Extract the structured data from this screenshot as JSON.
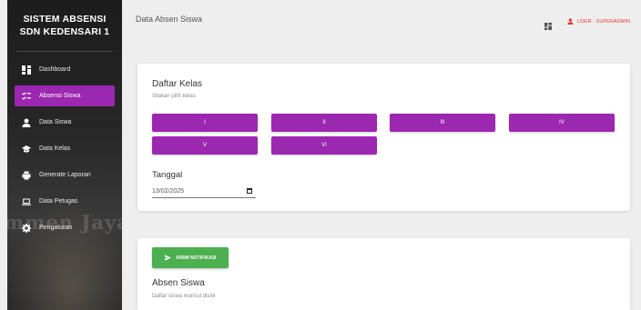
{
  "sidebar": {
    "brand_line1": "SISTEM ABSENSI",
    "brand_line2": "SDN KEDENSARI 1",
    "watermark": "mmen Jayand",
    "items": [
      {
        "label": "Dashboard",
        "icon": "dashboard-icon"
      },
      {
        "label": "Absensi Siswa",
        "icon": "checklist-icon",
        "active": true
      },
      {
        "label": "Data Siswa",
        "icon": "person-icon"
      },
      {
        "label": "Data Kelas",
        "icon": "school-icon"
      },
      {
        "label": "Generate Laporan",
        "icon": "print-icon"
      },
      {
        "label": "Data Petugas",
        "icon": "laptop-icon"
      },
      {
        "label": "Pengaturan",
        "icon": "gear-icon"
      }
    ]
  },
  "header": {
    "title": "Data Absen Siswa",
    "user_label": "USER : SUPERADMIN"
  },
  "kelas_card": {
    "title": "Daftar Kelas",
    "subtitle": "Silakan pilih kelas",
    "classes": [
      "I",
      "II",
      "III",
      "IV",
      "V",
      "VI"
    ],
    "date_label": "Tanggal",
    "date_value": "13/02/2025"
  },
  "absen_card": {
    "notif_button": "KIRIM NOTIFIKASI",
    "title": "Absen Siswa",
    "subtitle": "Daftar siswa muncul disini"
  },
  "colors": {
    "accent": "#9c27b0",
    "success": "#4caf50",
    "user": "#e53935"
  }
}
